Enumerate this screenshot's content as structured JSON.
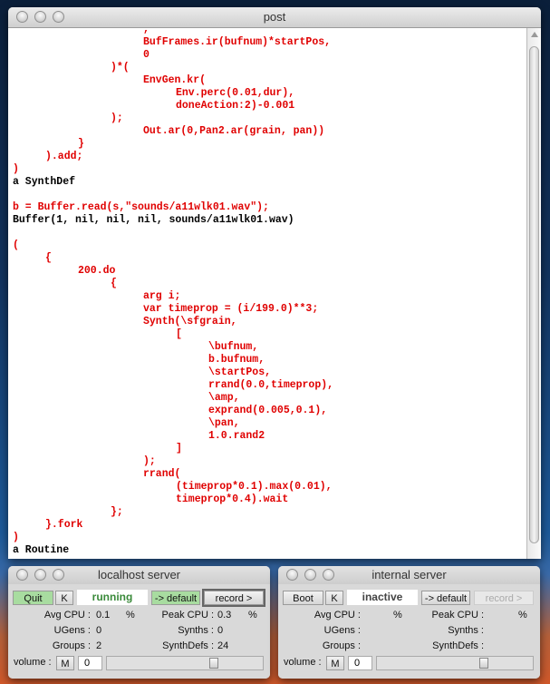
{
  "post_window": {
    "title": "post",
    "lines": [
      {
        "text": "\t\t\t\t,",
        "type": "in"
      },
      {
        "text": "\t\t\t\tBufFrames.ir(bufnum)*startPos,",
        "type": "in"
      },
      {
        "text": "\t\t\t\t0",
        "type": "in"
      },
      {
        "text": "\t\t\t)*(",
        "type": "in"
      },
      {
        "text": "\t\t\t\tEnvGen.kr(",
        "type": "in"
      },
      {
        "text": "\t\t\t\t\tEnv.perc(0.01,dur),",
        "type": "in"
      },
      {
        "text": "\t\t\t\t\tdoneAction:2)-0.001",
        "type": "in"
      },
      {
        "text": "\t\t\t);",
        "type": "in"
      },
      {
        "text": "\t\t\t\tOut.ar(0,Pan2.ar(grain, pan))",
        "type": "in"
      },
      {
        "text": "\t\t}",
        "type": "in"
      },
      {
        "text": "\t).add;",
        "type": "in"
      },
      {
        "text": ")",
        "type": "in"
      },
      {
        "text": "a SynthDef",
        "type": "out"
      },
      {
        "text": "",
        "type": "in"
      },
      {
        "text": "b = Buffer.read(s,\"sounds/a11wlk01.wav\");",
        "type": "in"
      },
      {
        "text": "Buffer(1, nil, nil, nil, sounds/a11wlk01.wav)",
        "type": "out"
      },
      {
        "text": "",
        "type": "in"
      },
      {
        "text": "(",
        "type": "in"
      },
      {
        "text": "\t{",
        "type": "in"
      },
      {
        "text": "\t\t200.do",
        "type": "in"
      },
      {
        "text": "\t\t\t{",
        "type": "in"
      },
      {
        "text": "\t\t\t\targ i;",
        "type": "in"
      },
      {
        "text": "\t\t\t\tvar timeprop = (i/199.0)**3;",
        "type": "in"
      },
      {
        "text": "\t\t\t\tSynth(\\sfgrain,",
        "type": "in"
      },
      {
        "text": "\t\t\t\t\t[",
        "type": "in"
      },
      {
        "text": "\t\t\t\t\t\t\\bufnum,",
        "type": "in"
      },
      {
        "text": "\t\t\t\t\t\tb.bufnum,",
        "type": "in"
      },
      {
        "text": "\t\t\t\t\t\t\\startPos,",
        "type": "in"
      },
      {
        "text": "\t\t\t\t\t\trrand(0.0,timeprop),",
        "type": "in"
      },
      {
        "text": "\t\t\t\t\t\t\\amp,",
        "type": "in"
      },
      {
        "text": "\t\t\t\t\t\texprand(0.005,0.1),",
        "type": "in"
      },
      {
        "text": "\t\t\t\t\t\t\\pan,",
        "type": "in"
      },
      {
        "text": "\t\t\t\t\t\t1.0.rand2",
        "type": "in"
      },
      {
        "text": "\t\t\t\t\t]",
        "type": "in"
      },
      {
        "text": "\t\t\t\t);",
        "type": "in"
      },
      {
        "text": "\t\t\t\trrand(",
        "type": "in"
      },
      {
        "text": "\t\t\t\t\t(timeprop*0.1).max(0.01),",
        "type": "in"
      },
      {
        "text": "\t\t\t\t\ttimeprop*0.4).wait",
        "type": "in"
      },
      {
        "text": "\t\t\t};",
        "type": "in"
      },
      {
        "text": "\t}.fork",
        "type": "in"
      },
      {
        "text": ")",
        "type": "in"
      },
      {
        "text": "a Routine",
        "type": "out"
      }
    ],
    "scroll_fraction": 1.0
  },
  "localhost": {
    "title": "localhost server",
    "boot_label": "Quit",
    "kill_label": "K",
    "status": "running",
    "default_label": "-> default",
    "record_label": "record >",
    "avg_cpu_label": "Avg CPU :",
    "avg_cpu": "0.1",
    "peak_cpu_label": "Peak CPU :",
    "peak_cpu": "0.3",
    "pct": "%",
    "ugens_label": "UGens :",
    "ugens": "0",
    "synths_label": "Synths :",
    "synths": "0",
    "groups_label": "Groups :",
    "groups": "2",
    "synthdefs_label": "SynthDefs :",
    "synthdefs": "24",
    "volume_label": "volume :",
    "mute_label": "M",
    "volume": "0"
  },
  "internal": {
    "title": "internal server",
    "boot_label": "Boot",
    "kill_label": "K",
    "status": "inactive",
    "default_label": "-> default",
    "record_label": "record >",
    "avg_cpu_label": "Avg CPU :",
    "peak_cpu_label": "Peak CPU :",
    "pct": "%",
    "ugens_label": "UGens :",
    "synths_label": "Synths :",
    "groups_label": "Groups :",
    "synthdefs_label": "SynthDefs :",
    "volume_label": "volume :",
    "mute_label": "M",
    "volume": "0"
  },
  "colors": {
    "code": "#e00000",
    "output": "#000000",
    "running": "#3a8a3a"
  }
}
